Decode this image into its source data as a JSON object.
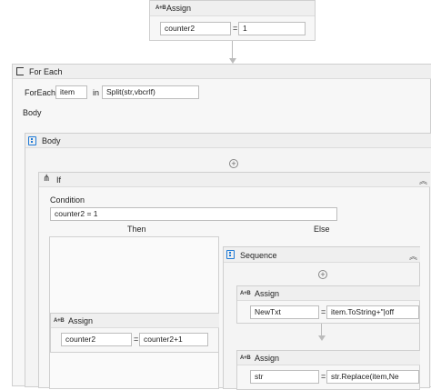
{
  "top_assign": {
    "title": "Assign",
    "icon": "assign-icon",
    "to": "counter2",
    "equals": "=",
    "value": "1"
  },
  "foreach": {
    "title": "For Each",
    "icon": "foreach-icon",
    "foreach_label": "ForEach",
    "item": "item",
    "in_label": "in",
    "values": "Split(str,vbcrlf)",
    "body_label": "Body"
  },
  "body_seq": {
    "title": "Body",
    "icon": "sequence-icon"
  },
  "if": {
    "title": "If",
    "icon": "if-icon",
    "condition_label": "Condition",
    "condition": "counter2 = 1",
    "then_label": "Then",
    "else_label": "Else"
  },
  "then_assign": {
    "title": "Assign",
    "to": "counter2",
    "equals": "=",
    "value": "counter2+1"
  },
  "else_seq": {
    "title": "Sequence",
    "icon": "sequence-icon"
  },
  "else_assign1": {
    "title": "Assign",
    "to": "NewTxt",
    "equals": "=",
    "value": "item.ToString+\"|off"
  },
  "else_assign2": {
    "title": "Assign",
    "to": "str",
    "equals": "=",
    "value": "str.Replace(item,Ne"
  },
  "colors": {
    "accent": "#1e7ad6",
    "card": "#f7f7f7",
    "border": "#cfcfcf"
  }
}
